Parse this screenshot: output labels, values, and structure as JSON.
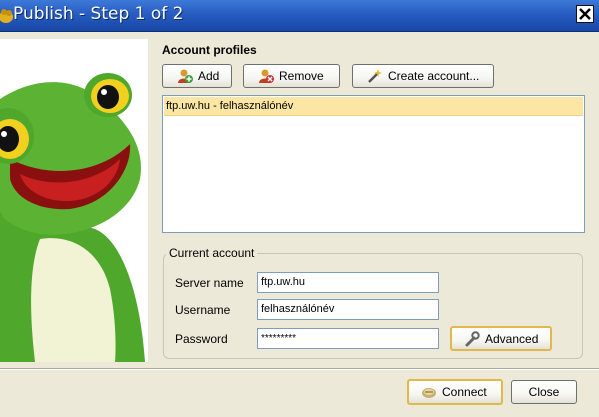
{
  "window": {
    "title": "Publish - Step 1 of 2"
  },
  "profiles": {
    "heading": "Account profiles",
    "add_label": "Add",
    "remove_label": "Remove",
    "create_label": "Create account...",
    "items": [
      {
        "label": "ftp.uw.hu - felhasználónév",
        "selected": true
      }
    ]
  },
  "current_account": {
    "legend": "Current account",
    "server_label": "Server name",
    "server_value": "ftp.uw.hu",
    "username_label": "Username",
    "username_value": "felhasználónév",
    "password_label": "Password",
    "password_value": "*********",
    "advanced_label": "Advanced"
  },
  "footer": {
    "connect_label": "Connect",
    "close_label": "Close"
  },
  "colors": {
    "titlebar": "#2a5fc4",
    "selection": "#fce6a4",
    "dialog_bg": "#ece9d8",
    "default_button_border": "#e2b84e"
  },
  "icons": {
    "window": "frog-app-icon",
    "close": "close-icon",
    "add": "add-user-icon",
    "remove": "remove-user-icon",
    "create": "wizard-icon",
    "advanced": "wrench-icon",
    "connect": "connect-icon"
  }
}
